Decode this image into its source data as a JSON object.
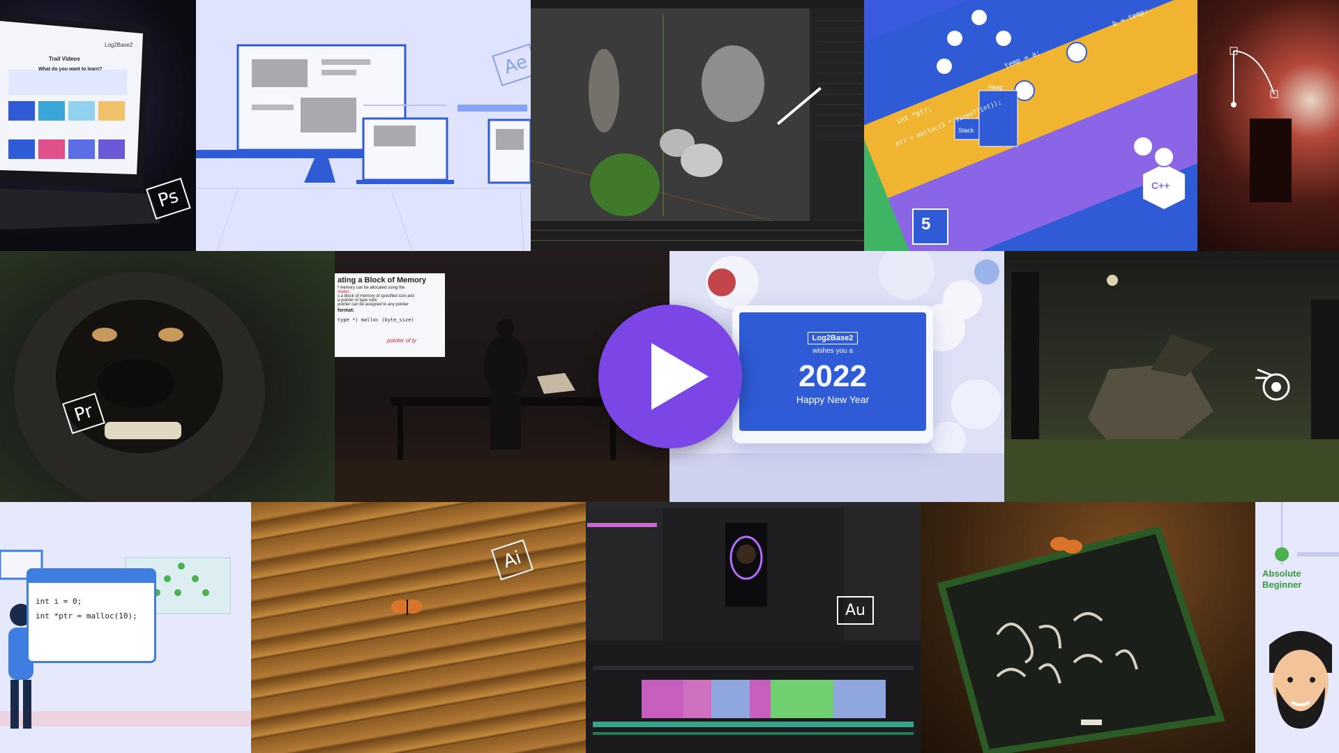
{
  "badges": {
    "photoshop": "Ps",
    "after_effects": "Ae",
    "premiere": "Pr",
    "illustrator": "Ai",
    "audition": "Au"
  },
  "laptop_screen": {
    "title": "Trail Videos",
    "prompt": "What do you want to learn?",
    "brand": "Log2Base2"
  },
  "ds_tile": {
    "css_label": "5",
    "cpp_label": "C++",
    "code_line_1": "int *ptr;",
    "code_line_2": "ptr = malloc(5 * sizeof(int));",
    "stack_label": "Stack",
    "heap_label": "Heap",
    "swap_code": "temp = a;",
    "swap_code_2": "b = temp;"
  },
  "lesson_slide": {
    "title": "ating a Block of Memory",
    "line1": "f memory can be allocated using the",
    "line2": "malloc.",
    "line3": "s a block of memory of specified size and",
    "line4": "a pointer of type void.",
    "line5": "pointer can be assigned to any pointer",
    "line6": "format:",
    "code": "type *) malloc (byte_size)",
    "handwritten": "pointer of ty"
  },
  "new_year": {
    "brand": "Log2Base2",
    "wishes": "wishes you a",
    "year": "2022",
    "message": "Happy New Year"
  },
  "code_card": {
    "line1": "int i = 0;",
    "line2": "int *ptr = malloc(10);"
  },
  "beginner": {
    "label_line1": "Absolute",
    "label_line2": "Beginner"
  },
  "colors": {
    "play": "#7b46e6",
    "brand_blue": "#2f5bd6",
    "accent_green": "#4caf50"
  }
}
